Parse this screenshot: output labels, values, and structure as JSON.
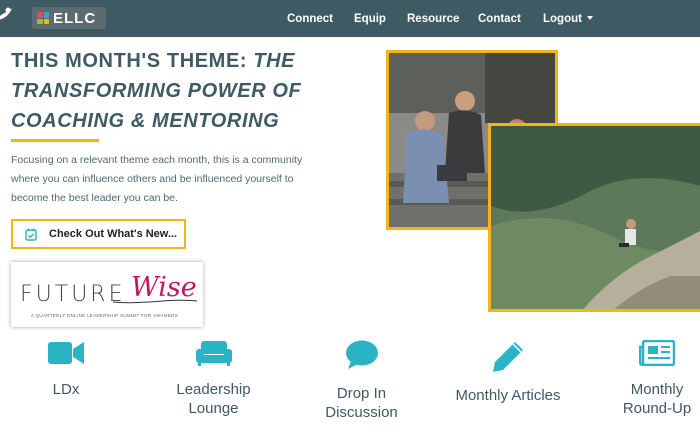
{
  "brand": {
    "logo_text": "ELLC"
  },
  "nav": {
    "items": [
      "Connect",
      "Equip",
      "Resource",
      "Contact"
    ],
    "logout_label": "Logout"
  },
  "hero": {
    "title_prefix": "THIS MONTH'S THEME: ",
    "title_italic_1": "THE",
    "title_line2": "TRANSFORMING POWER OF",
    "title_line3": "COACHING & MENTORING",
    "description": "Focusing on a relevant theme each month, this is a community where you can influence others and be influenced yourself to become the best leader you can be.",
    "cta_label": "Check Out What's New..."
  },
  "futurewise": {
    "logo_text_1": "FUTURE",
    "logo_text_2": "Wise",
    "tagline": "A QUARTERLY ONLINE LEADERSHIP SUMMIT FOR YWAMERS"
  },
  "features": [
    {
      "label_1": "LDx",
      "label_2": "",
      "icon": "video-camera-icon"
    },
    {
      "label_1": "Leadership",
      "label_2": "Lounge",
      "icon": "sofa-icon"
    },
    {
      "label_1": "Drop In",
      "label_2": "Discussion",
      "icon": "chat-bubble-icon"
    },
    {
      "label_1": "Monthly Articles",
      "label_2": "",
      "icon": "pen-icon"
    },
    {
      "label_1": "Monthly",
      "label_2": "Round-Up",
      "icon": "newspaper-icon"
    }
  ],
  "colors": {
    "header_bg": "#3e5a62",
    "accent_yellow": "#f2b519",
    "icon_teal": "#2ab3c4",
    "text_slate": "#3e5a62"
  }
}
